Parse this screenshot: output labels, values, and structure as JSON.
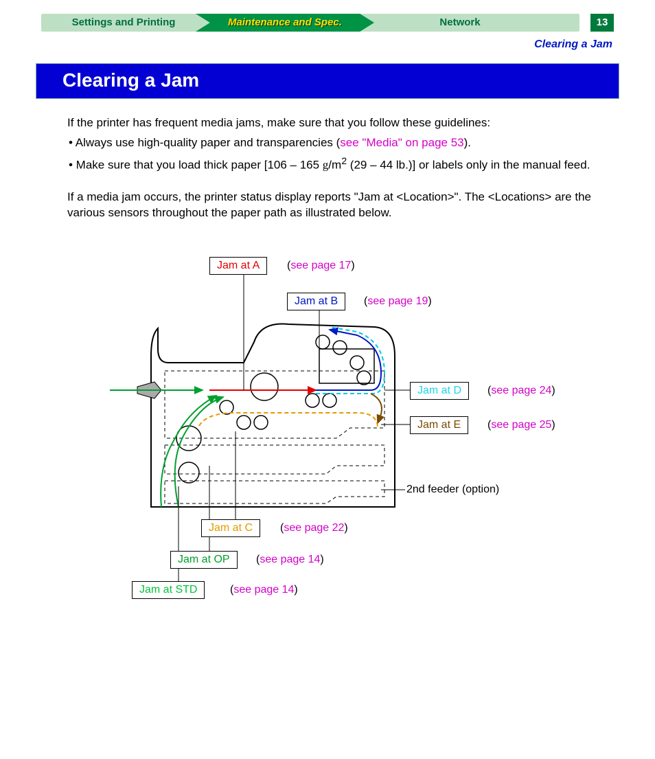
{
  "nav": {
    "tab1": "Settings and Printing",
    "tab2": "Maintenance and Spec.",
    "tab3": "Network",
    "page_number": "13"
  },
  "breadcrumb": "Clearing a Jam",
  "heading": "Clearing a Jam",
  "intro": "If the printer has frequent media jams, make sure that you follow these guidelines:",
  "bullets": {
    "b1_pre": "• Always use high-quality paper and transparencies (",
    "b1_link": "see \"Media\" on page 53",
    "b1_post": ").",
    "b2_pre": "• Make sure that you load thick paper [106 – 165 ",
    "b2_unit1": "g",
    "b2_unit2": "/m",
    "b2_sup": "2",
    "b2_post": " (29 – 44 lb.)] or labels only in the manual feed."
  },
  "para2": "If a media jam occurs, the printer status display reports \"Jam at <Location>\". The <Locations> are the various sensors throughout the paper path as illustrated below.",
  "diagram": {
    "A": {
      "label": "Jam at A",
      "ref": "see page 17"
    },
    "B": {
      "label": "Jam at B",
      "ref": "see page 19"
    },
    "C": {
      "label": "Jam at C",
      "ref": "see page 22"
    },
    "D": {
      "label": "Jam at D",
      "ref": "see page 24"
    },
    "E": {
      "label": "Jam at E",
      "ref": "see page 25"
    },
    "OP": {
      "label": "Jam at OP",
      "ref": "see page 14"
    },
    "STD": {
      "label": "Jam at STD",
      "ref": "see page 14"
    },
    "feeder": "2nd feeder (option)"
  }
}
